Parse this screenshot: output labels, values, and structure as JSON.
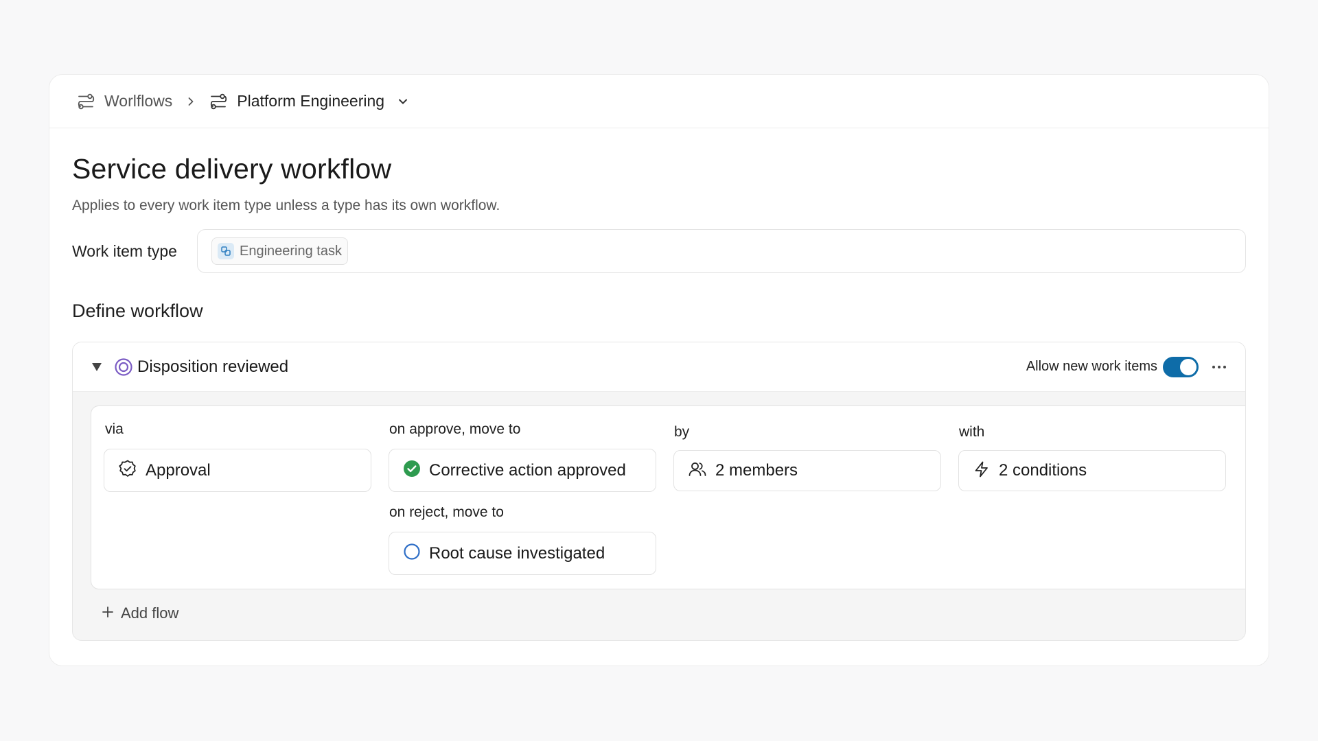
{
  "breadcrumb": {
    "root_label": "Worlflows",
    "current_label": "Platform Engineering"
  },
  "page": {
    "title": "Service delivery workflow",
    "description": "Applies to every work item type unless a type has its own workflow."
  },
  "work_item_type": {
    "label": "Work item type",
    "chip_label": "Engineering task"
  },
  "define_section": {
    "title": "Define workflow"
  },
  "workflow_state": {
    "name": "Disposition reviewed",
    "allow_new_label": "Allow new work items",
    "allow_new_enabled": true,
    "flow": {
      "via_label": "via",
      "via_value": "Approval",
      "approve_label": "on approve, move to",
      "approve_value": "Corrective action approved",
      "reject_label": "on reject, move to",
      "reject_value": "Root cause investigated",
      "by_label": "by",
      "by_value": "2 members",
      "with_label": "with",
      "with_value": "2 conditions"
    },
    "add_flow_label": "Add flow"
  },
  "colors": {
    "accent": "#0e6ca8",
    "state_purple": "#7b5cc4",
    "approved_green": "#2e9b4f",
    "reject_blue": "#2f6fc7"
  },
  "icons": {
    "workflow": "workflow-icon",
    "chevron_right": "chevron-right-icon",
    "chevron_down": "chevron-down-icon",
    "task": "engineering-task-icon",
    "state": "state-ring-icon",
    "approval": "approval-badge-icon",
    "check": "check-circle-icon",
    "circle": "empty-circle-icon",
    "members": "members-icon",
    "bolt": "lightning-icon",
    "plus": "plus-icon",
    "more": "more-dots-icon"
  }
}
